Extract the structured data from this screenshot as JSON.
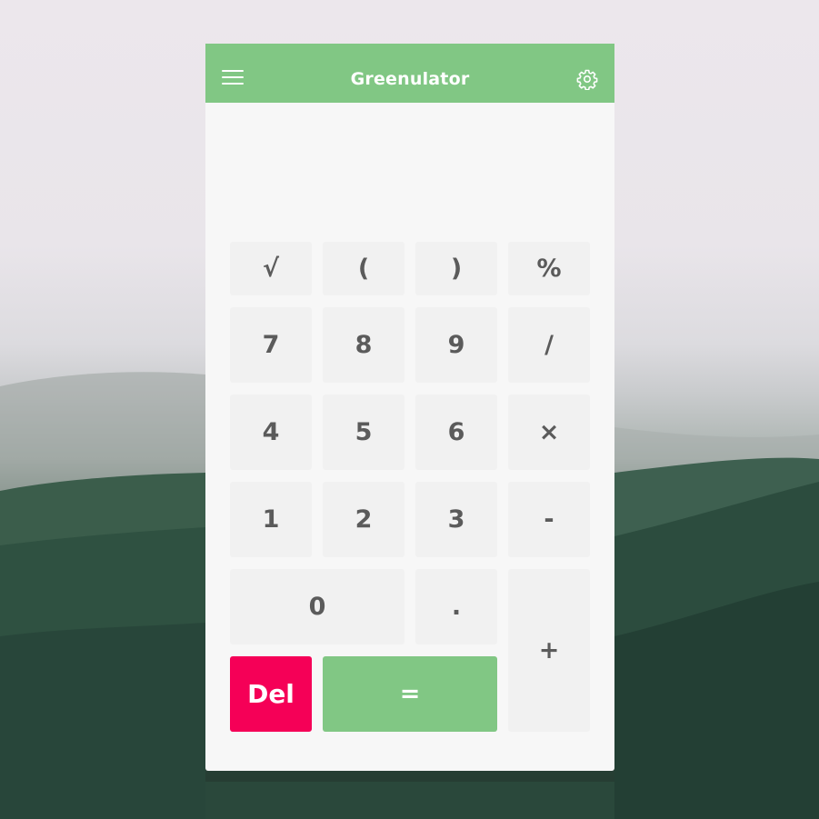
{
  "header": {
    "title": "Greenulator",
    "menu_icon": "hamburger-menu-icon",
    "settings_icon": "gear-icon",
    "color": "#81c784"
  },
  "display": {
    "value": ""
  },
  "keys": {
    "sqrt": "√",
    "lparen": "(",
    "rparen": ")",
    "percent": "%",
    "seven": "7",
    "eight": "8",
    "nine": "9",
    "divide": "/",
    "four": "4",
    "five": "5",
    "six": "6",
    "multiply": "×",
    "one": "1",
    "two": "2",
    "three": "3",
    "minus": "-",
    "zero": "0",
    "decimal": ".",
    "plus": "+",
    "del": "Del",
    "equals": "="
  },
  "colors": {
    "del": "#f50057",
    "equals": "#81c784",
    "key_bg": "#f1f1f1",
    "panel_bg": "#f7f7f7"
  }
}
